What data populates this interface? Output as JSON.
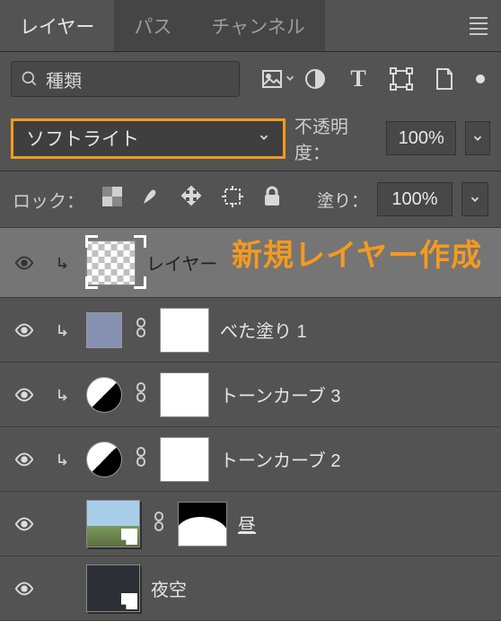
{
  "tabs": {
    "layers": "レイヤー",
    "paths": "パス",
    "channels": "チャンネル"
  },
  "filter": {
    "placeholder": "種類"
  },
  "blend": {
    "mode": "ソフトライト",
    "opacity_label": "不透明度：",
    "opacity_value": "100%"
  },
  "lock": {
    "label": "ロック：",
    "fill_label": "塗り：",
    "fill_value": "100%"
  },
  "layers": {
    "l1": "レイヤー",
    "l2": "べた塗り 1",
    "l3": "トーンカーブ 3",
    "l4": "トーンカーブ 2",
    "l5": "昼",
    "l6": "夜空"
  },
  "annotation": "新規レイヤー作成"
}
